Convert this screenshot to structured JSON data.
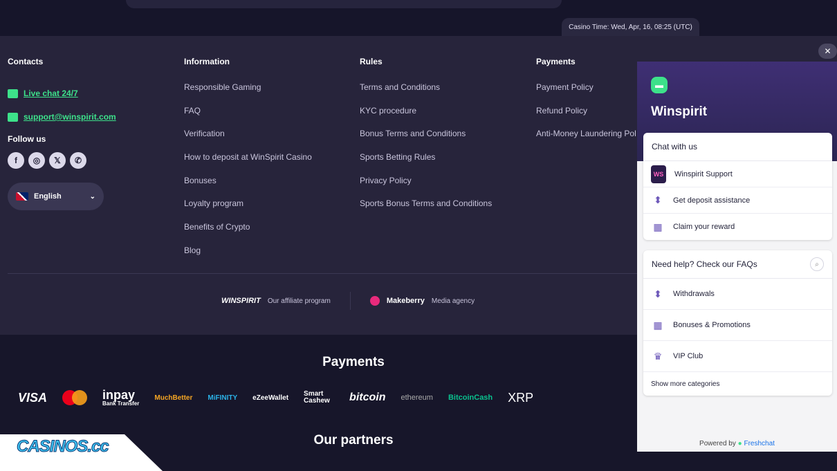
{
  "header": {
    "casino_time": "Casino Time: Wed, Apr, 16, 08:25 (UTC)"
  },
  "footer": {
    "contacts": {
      "title": "Contacts",
      "live_chat": "Live chat 24/7",
      "email": "support@winspirit.com",
      "follow_us": "Follow us",
      "language": "English"
    },
    "information": {
      "title": "Information",
      "links": [
        "Responsible Gaming",
        "FAQ",
        "Verification",
        "How to deposit at WinSpirit Casino",
        "Bonuses",
        "Loyalty program",
        "Benefits of Crypto",
        "Blog"
      ]
    },
    "rules": {
      "title": "Rules",
      "links": [
        "Terms and Conditions",
        "KYC procedure",
        "Bonus Terms and Conditions",
        "Sports Betting Rules",
        "Privacy Policy",
        "Sports Bonus Terms and Conditions"
      ]
    },
    "payments": {
      "title": "Payments",
      "links": [
        "Payment Policy",
        "Refund Policy",
        "Anti-Money Laundering Pol"
      ]
    },
    "affiliate": {
      "logo": "WINSPIRIT",
      "text": "Our affiliate program"
    },
    "media": {
      "logo": "Makeberry",
      "text": "Media agency"
    }
  },
  "payments_section": {
    "title": "Payments",
    "logos": [
      "VISA",
      "inpay",
      "MuchBetter",
      "MiFINITY",
      "eZeeWallet",
      "Smart Cashew",
      "bitcoin",
      "ethereum",
      "BitcoinCash",
      "XRP"
    ],
    "inpay_sub": "Bank Transfer"
  },
  "partners_section": {
    "title": "Our partners"
  },
  "watermark": "CASINOS.cc",
  "chat_widget": {
    "title": "Winspirit",
    "chat_with_us": "Chat with us",
    "chat_items": [
      "Winspirit Support",
      "Get deposit assistance",
      "Claim your reward"
    ],
    "faq_title": "Need help? Check our FAQs",
    "faq_items": [
      "Withdrawals",
      "Bonuses & Promotions",
      "VIP Club"
    ],
    "show_more": "Show more categories",
    "powered_by": "Powered by",
    "powered_brand": "Freshchat"
  }
}
